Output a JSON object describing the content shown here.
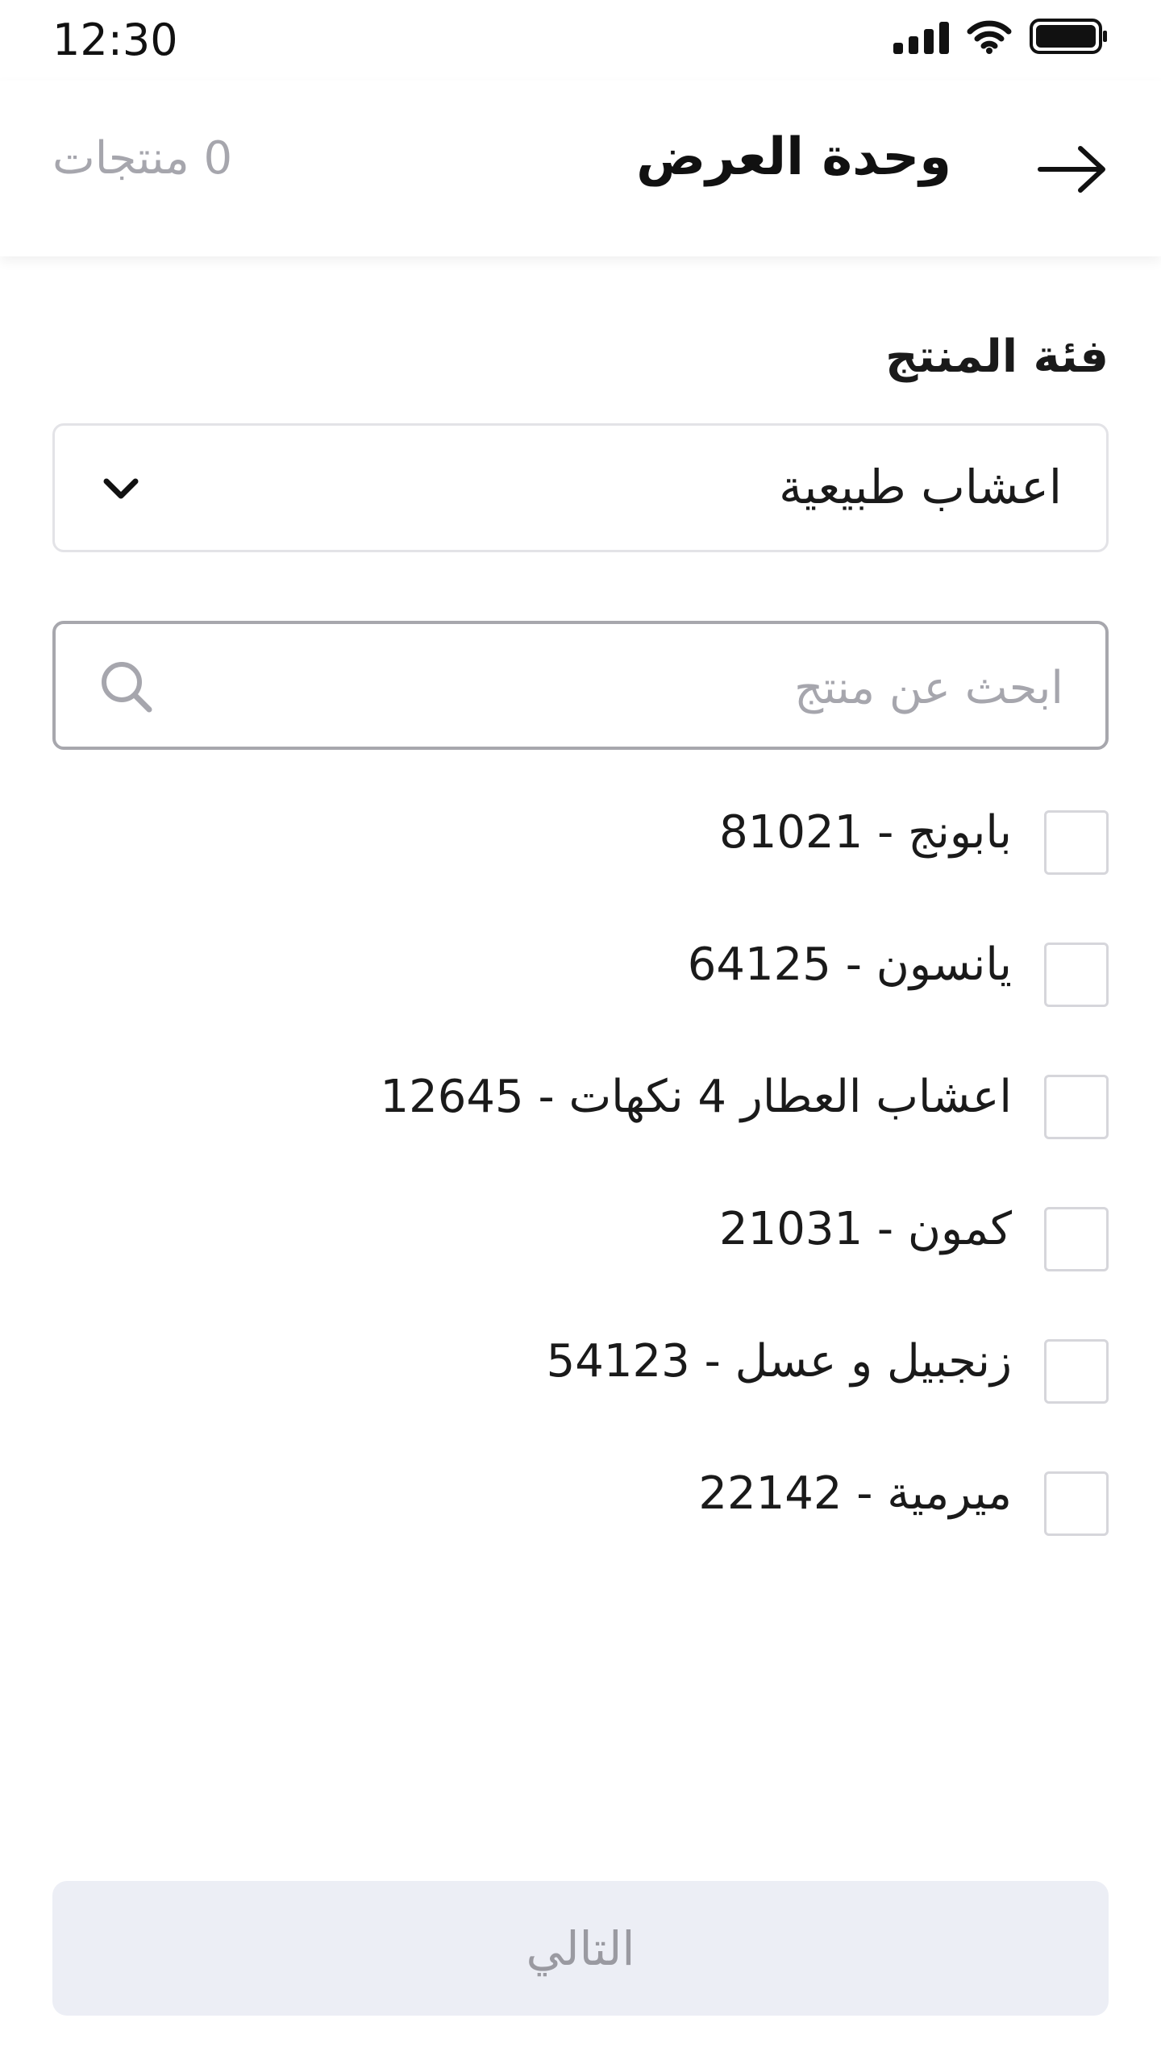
{
  "status_bar": {
    "time": "12:30"
  },
  "header": {
    "title": "وحدة العرض",
    "products_count": "0 منتجات",
    "back_icon": "arrow-right-icon"
  },
  "category": {
    "label": "فئة المنتج",
    "selected": "اعشاب طبيعية",
    "chevron_icon": "chevron-down-icon"
  },
  "search": {
    "placeholder": "ابحث عن منتج",
    "value": "",
    "icon": "search-icon"
  },
  "products": [
    {
      "label": "بابونج - 81021",
      "checked": false
    },
    {
      "label": "يانسون - 64125",
      "checked": false
    },
    {
      "label": "اعشاب العطار 4 نكهات - 12645",
      "checked": false
    },
    {
      "label": "كمون - 21031",
      "checked": false
    },
    {
      "label": "زنجبيل و عسل - 54123",
      "checked": false
    },
    {
      "label": "ميرمية - 22142",
      "checked": false
    }
  ],
  "footer": {
    "next_label": "التالي"
  }
}
